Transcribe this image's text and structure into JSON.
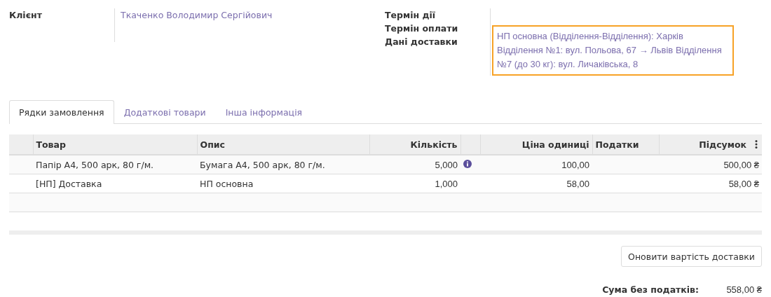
{
  "form": {
    "left_fields": [
      {
        "label": "Клієнт",
        "value": "Ткаченко Володимир Сергійович"
      }
    ],
    "right_fields": [
      {
        "label": "Термін дії"
      },
      {
        "label": "Термін оплати"
      },
      {
        "label": "Дані доставки",
        "value": "НП основна (Відділення-Відділення): Харків Відділення №1: вул. Польова, 67 → Львів Відділення №7 (до 30 кг): вул. Личаківська, 8",
        "highlighted": true
      }
    ]
  },
  "tabs": [
    {
      "label": "Рядки замовлення",
      "selected": true
    },
    {
      "label": "Додаткові товари",
      "selected": false
    },
    {
      "label": "Інша інформація",
      "selected": false
    }
  ],
  "table": {
    "columns": [
      "Товар",
      "Опис",
      "Кількість",
      "Ціна одиниці",
      "Податки",
      "Підсумок"
    ],
    "rows": [
      {
        "product": "Папір А4, 500 арк, 80 г/м.",
        "description": "Бумага А4, 500 арк, 80 г/м.",
        "quantity": "5,000",
        "info": true,
        "unit_price": "100,00",
        "subtotal": "500,00 ₴"
      },
      {
        "product": "[НП] Доставка",
        "description": "НП основна",
        "quantity": "1,000",
        "info": false,
        "unit_price": "58,00",
        "subtotal": "58,00 ₴"
      }
    ]
  },
  "update_button": "Оновити вартість доставки",
  "totals": [
    {
      "label": "Сума без податків:",
      "value": "558,00 ₴"
    }
  ]
}
